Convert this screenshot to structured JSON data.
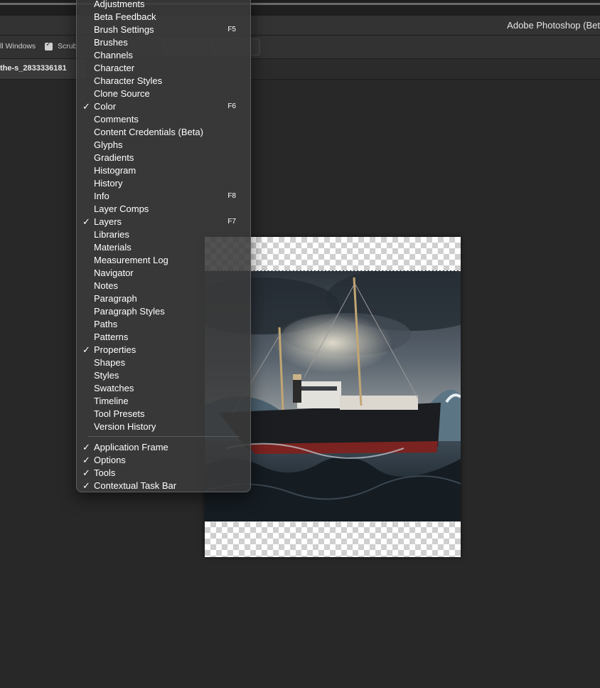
{
  "app_title": "Adobe Photoshop (Bet",
  "options_bar": {
    "all_windows": "ll Windows",
    "scrub": "Scrub"
  },
  "document_tab": {
    "title": "the-s_2833336181"
  },
  "window_menu": {
    "items": [
      {
        "label": "Adjustments",
        "checked": false,
        "shortcut": ""
      },
      {
        "label": "Beta Feedback",
        "checked": false,
        "shortcut": ""
      },
      {
        "label": "Brush Settings",
        "checked": false,
        "shortcut": "F5"
      },
      {
        "label": "Brushes",
        "checked": false,
        "shortcut": ""
      },
      {
        "label": "Channels",
        "checked": false,
        "shortcut": ""
      },
      {
        "label": "Character",
        "checked": false,
        "shortcut": ""
      },
      {
        "label": "Character Styles",
        "checked": false,
        "shortcut": ""
      },
      {
        "label": "Clone Source",
        "checked": false,
        "shortcut": ""
      },
      {
        "label": "Color",
        "checked": true,
        "shortcut": "F6"
      },
      {
        "label": "Comments",
        "checked": false,
        "shortcut": ""
      },
      {
        "label": "Content Credentials (Beta)",
        "checked": false,
        "shortcut": ""
      },
      {
        "label": "Glyphs",
        "checked": false,
        "shortcut": ""
      },
      {
        "label": "Gradients",
        "checked": false,
        "shortcut": ""
      },
      {
        "label": "Histogram",
        "checked": false,
        "shortcut": ""
      },
      {
        "label": "History",
        "checked": false,
        "shortcut": ""
      },
      {
        "label": "Info",
        "checked": false,
        "shortcut": "F8"
      },
      {
        "label": "Layer Comps",
        "checked": false,
        "shortcut": ""
      },
      {
        "label": "Layers",
        "checked": true,
        "shortcut": "F7"
      },
      {
        "label": "Libraries",
        "checked": false,
        "shortcut": ""
      },
      {
        "label": "Materials",
        "checked": false,
        "shortcut": ""
      },
      {
        "label": "Measurement Log",
        "checked": false,
        "shortcut": ""
      },
      {
        "label": "Navigator",
        "checked": false,
        "shortcut": ""
      },
      {
        "label": "Notes",
        "checked": false,
        "shortcut": ""
      },
      {
        "label": "Paragraph",
        "checked": false,
        "shortcut": ""
      },
      {
        "label": "Paragraph Styles",
        "checked": false,
        "shortcut": ""
      },
      {
        "label": "Paths",
        "checked": false,
        "shortcut": ""
      },
      {
        "label": "Patterns",
        "checked": false,
        "shortcut": ""
      },
      {
        "label": "Properties",
        "checked": true,
        "shortcut": ""
      },
      {
        "label": "Shapes",
        "checked": false,
        "shortcut": ""
      },
      {
        "label": "Styles",
        "checked": false,
        "shortcut": ""
      },
      {
        "label": "Swatches",
        "checked": false,
        "shortcut": ""
      },
      {
        "label": "Timeline",
        "checked": false,
        "shortcut": ""
      },
      {
        "label": "Tool Presets",
        "checked": false,
        "shortcut": ""
      },
      {
        "label": "Version History",
        "checked": false,
        "shortcut": ""
      }
    ],
    "workspace_items": [
      {
        "label": "Application Frame",
        "checked": true
      },
      {
        "label": "Options",
        "checked": true
      },
      {
        "label": "Tools",
        "checked": true
      },
      {
        "label": "Contextual Task Bar",
        "checked": true
      }
    ]
  },
  "colors": {
    "workspace_bg": "#282828",
    "menu_bg": "#3a3a3a",
    "menu_text": "#ffffff"
  },
  "icons": {
    "checkmark": "checkmark-icon",
    "checkbox": "checkbox-icon"
  }
}
